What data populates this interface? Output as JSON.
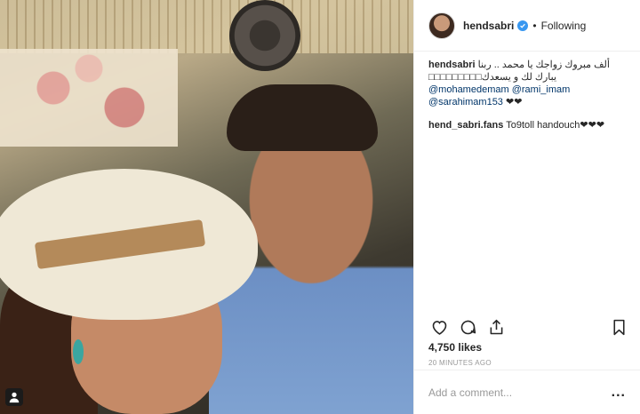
{
  "header": {
    "username": "hendsabri",
    "verified_icon": "verified-badge-icon",
    "separator": "•",
    "follow_status": "Following"
  },
  "caption": {
    "username": "hendsabri",
    "text": "ألف مبروك زواجك يا محمد .. ربنا يبارك لك و يسعدك□□□□□□□□□",
    "mentions": [
      "@mohamedemam",
      "@rami_imam",
      "@sarahimam153"
    ],
    "trailing": "❤❤"
  },
  "comment": {
    "username": "hend_sabri.fans",
    "text": "To9toll handouch❤❤❤"
  },
  "actions": {
    "like_icon": "heart-icon",
    "comment_icon": "comment-icon",
    "share_icon": "share-icon",
    "save_icon": "bookmark-icon"
  },
  "stats": {
    "likes": "4,750 likes",
    "time_ago": "20 MINUTES AGO"
  },
  "add_comment": {
    "placeholder": "Add a comment...",
    "more": "..."
  },
  "photo": {
    "tag_icon": "user-tag-icon"
  }
}
